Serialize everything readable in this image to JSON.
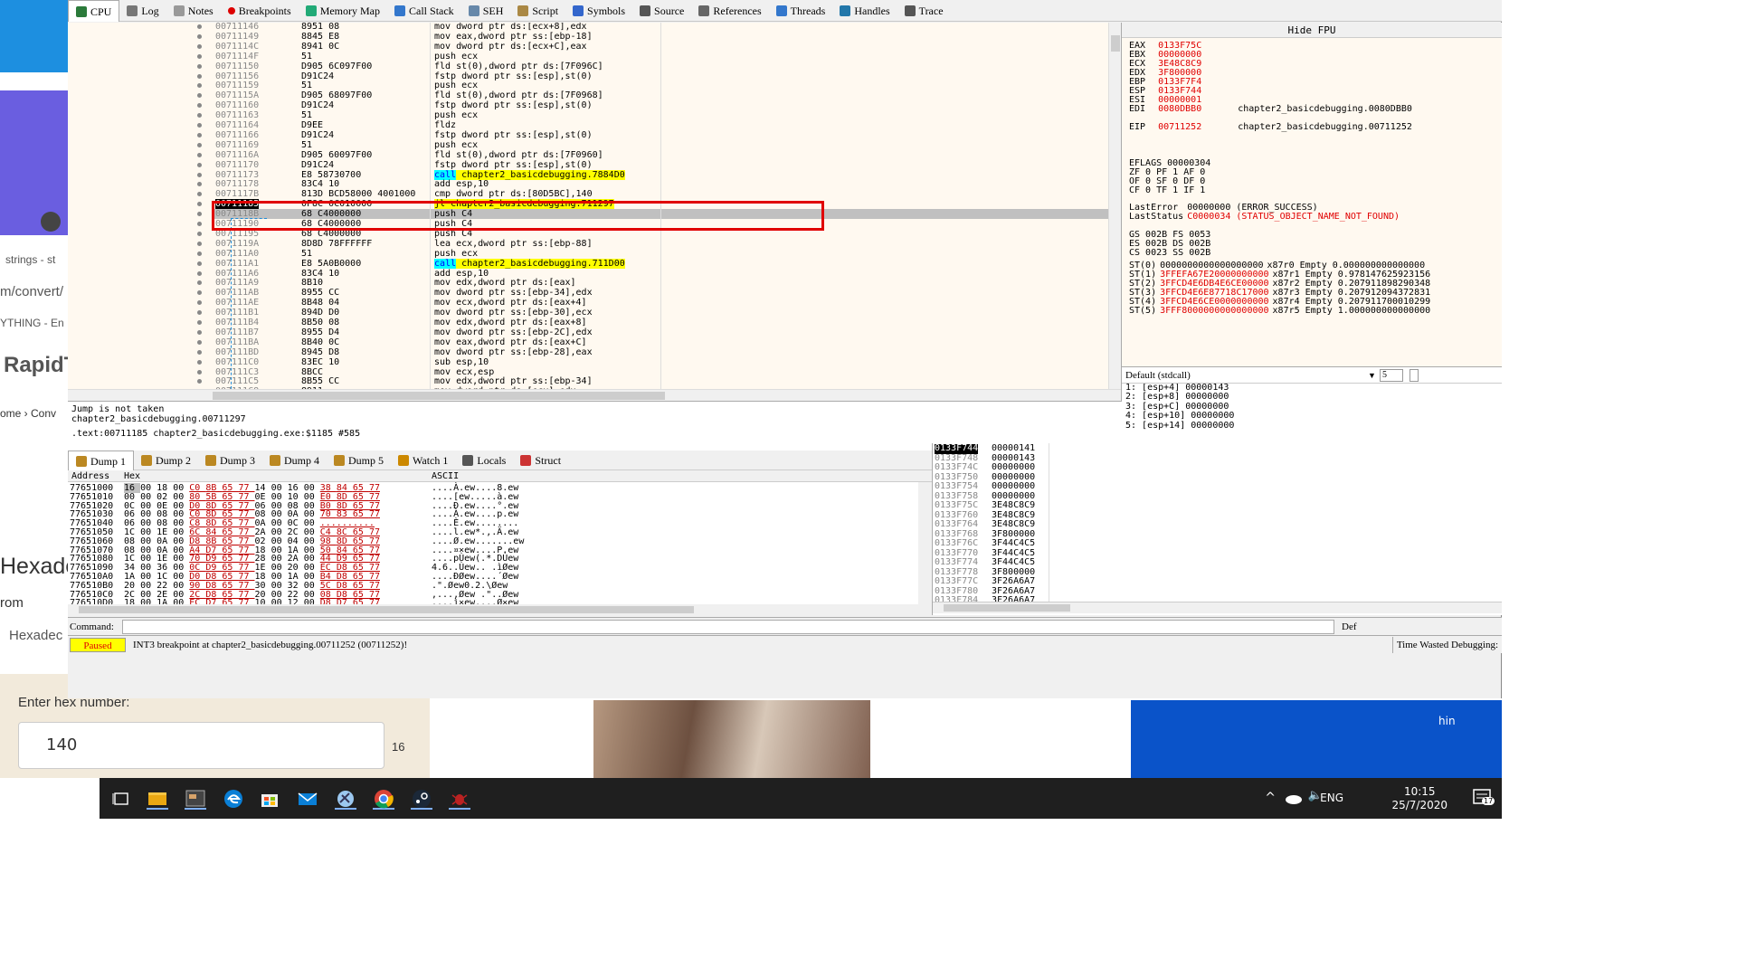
{
  "bg_browser": {
    "strings_tab": "strings - st",
    "url_fragment": "m/convert/",
    "thing_tab": "YTHING - En",
    "site_name": "RapidT",
    "breadcrumb": "ome › Conv",
    "heading_fragment": "Hexade",
    "from_label": "rom",
    "hexadec_label": "Hexadec",
    "enter_hex_label": "Enter hex number:",
    "hex_input_value": "140",
    "base_label": "16",
    "right_label": "hin"
  },
  "tabs": [
    {
      "label": "CPU",
      "icon": "cpu-icon"
    },
    {
      "label": "Log",
      "icon": "log-icon"
    },
    {
      "label": "Notes",
      "icon": "notes-icon"
    },
    {
      "label": "Breakpoints",
      "icon": "breakpoint-icon"
    },
    {
      "label": "Memory Map",
      "icon": "memory-map-icon"
    },
    {
      "label": "Call Stack",
      "icon": "call-stack-icon"
    },
    {
      "label": "SEH",
      "icon": "seh-icon"
    },
    {
      "label": "Script",
      "icon": "script-icon"
    },
    {
      "label": "Symbols",
      "icon": "symbols-icon"
    },
    {
      "label": "Source",
      "icon": "source-icon"
    },
    {
      "label": "References",
      "icon": "references-icon"
    },
    {
      "label": "Threads",
      "icon": "threads-icon"
    },
    {
      "label": "Handles",
      "icon": "handles-icon"
    },
    {
      "label": "Trace",
      "icon": "trace-icon"
    }
  ],
  "disasm": [
    {
      "addr": "00711146",
      "bytes": "8951 08",
      "instr": "mov dword ptr ds:[ecx+8],edx"
    },
    {
      "addr": "00711149",
      "bytes": "8845 E8",
      "instr": "mov eax,dword ptr ss:[ebp-18]"
    },
    {
      "addr": "0071114C",
      "bytes": "8941 0C",
      "instr": "mov dword ptr ds:[ecx+C],eax"
    },
    {
      "addr": "0071114F",
      "bytes": "51",
      "instr": "push ecx"
    },
    {
      "addr": "00711150",
      "bytes": "D905 6C097F00",
      "instr": "fld st(0),dword ptr ds:[7F096C]"
    },
    {
      "addr": "00711156",
      "bytes": "D91C24",
      "instr": "fstp dword ptr ss:[esp],st(0)"
    },
    {
      "addr": "00711159",
      "bytes": "51",
      "instr": "push ecx"
    },
    {
      "addr": "0071115A",
      "bytes": "D905 68097F00",
      "instr": "fld st(0),dword ptr ds:[7F0968]"
    },
    {
      "addr": "00711160",
      "bytes": "D91C24",
      "instr": "fstp dword ptr ss:[esp],st(0)"
    },
    {
      "addr": "00711163",
      "bytes": "51",
      "instr": "push ecx"
    },
    {
      "addr": "00711164",
      "bytes": "D9EE",
      "instr": "fldz"
    },
    {
      "addr": "00711166",
      "bytes": "D91C24",
      "instr": "fstp dword ptr ss:[esp],st(0)"
    },
    {
      "addr": "00711169",
      "bytes": "51",
      "instr": "push ecx"
    },
    {
      "addr": "0071116A",
      "bytes": "D905 60097F00",
      "instr": "fld st(0),dword ptr ds:[7F0960]"
    },
    {
      "addr": "00711170",
      "bytes": "D91C24",
      "instr": "fstp dword ptr ss:[esp],st(0)"
    },
    {
      "addr": "00711173",
      "bytes": "E8 58730700",
      "instr": "call chapter2_basicdebugging.7884D0",
      "hl": "call"
    },
    {
      "addr": "00711178",
      "bytes": "83C4 10",
      "instr": "add esp,10"
    },
    {
      "addr": "0071117B",
      "bytes": "813D BCD58000 4001000",
      "instr": "cmp dword ptr ds:[80D5BC],140"
    },
    {
      "addr": "00711185",
      "bytes": "0F8C 0C010000",
      "instr": "jl chapter2_basicdebugging.711297",
      "hl": "jmp",
      "current": true
    },
    {
      "addr": "0071118B",
      "bytes": "68 C4000000",
      "instr": "push C4"
    },
    {
      "addr": "00711190",
      "bytes": "68 C4000000",
      "instr": "push C4"
    },
    {
      "addr": "00711195",
      "bytes": "68 C4000000",
      "instr": "push C4"
    },
    {
      "addr": "0071119A",
      "bytes": "8D8D 78FFFFFF",
      "instr": "lea ecx,dword ptr ss:[ebp-88]"
    },
    {
      "addr": "007111A0",
      "bytes": "51",
      "instr": "push ecx"
    },
    {
      "addr": "007111A1",
      "bytes": "E8 5A0B0000",
      "instr": "call chapter2_basicdebugging.711D00",
      "hl": "call"
    },
    {
      "addr": "007111A6",
      "bytes": "83C4 10",
      "instr": "add esp,10"
    },
    {
      "addr": "007111A9",
      "bytes": "8B10",
      "instr": "mov edx,dword ptr ds:[eax]"
    },
    {
      "addr": "007111AB",
      "bytes": "8955 CC",
      "instr": "mov dword ptr ss:[ebp-34],edx"
    },
    {
      "addr": "007111AE",
      "bytes": "8B48 04",
      "instr": "mov ecx,dword ptr ds:[eax+4]"
    },
    {
      "addr": "007111B1",
      "bytes": "894D D0",
      "instr": "mov dword ptr ss:[ebp-30],ecx"
    },
    {
      "addr": "007111B4",
      "bytes": "8B50 08",
      "instr": "mov edx,dword ptr ds:[eax+8]"
    },
    {
      "addr": "007111B7",
      "bytes": "8955 D4",
      "instr": "mov dword ptr ss:[ebp-2C],edx"
    },
    {
      "addr": "007111BA",
      "bytes": "8B40 0C",
      "instr": "mov eax,dword ptr ds:[eax+C]"
    },
    {
      "addr": "007111BD",
      "bytes": "8945 D8",
      "instr": "mov dword ptr ss:[ebp-28],eax"
    },
    {
      "addr": "007111C0",
      "bytes": "83EC 10",
      "instr": "sub esp,10"
    },
    {
      "addr": "007111C3",
      "bytes": "8BCC",
      "instr": "mov ecx,esp"
    },
    {
      "addr": "007111C5",
      "bytes": "8B55 CC",
      "instr": "mov edx,dword ptr ss:[ebp-34]"
    },
    {
      "addr": "007111C8",
      "bytes": "8911",
      "instr": "mov dword ptr ds:[ecx],edx"
    }
  ],
  "info": {
    "line1": "Jump is not taken",
    "line2": "chapter2_basicdebugging.00711297",
    "line3": ".text:00711185 chapter2_basicdebugging.exe:$1185 #585"
  },
  "regs": {
    "header": "Hide FPU",
    "rows": [
      {
        "n": "EAX",
        "v": "0133F75C",
        "c": ""
      },
      {
        "n": "EBX",
        "v": "00000000",
        "c": ""
      },
      {
        "n": "ECX",
        "v": "3E48C8C9",
        "c": ""
      },
      {
        "n": "EDX",
        "v": "3F800000",
        "c": ""
      },
      {
        "n": "EBP",
        "v": "0133F7F4",
        "c": ""
      },
      {
        "n": "ESP",
        "v": "0133F744",
        "c": ""
      },
      {
        "n": "ESI",
        "v": "00000001",
        "c": ""
      },
      {
        "n": "EDI",
        "v": "0080DBB0",
        "c": "chapter2_basicdebugging.0080DBB0"
      },
      {
        "n": "EIP",
        "v": "00711252",
        "c": "chapter2_basicdebugging.00711252"
      }
    ],
    "eflags": "EFLAGS   00000304",
    "flags1": "ZF 0  PF 1  AF 0",
    "flags2": "OF 0  SF 0  DF 0",
    "flags3": "CF 0  TF 1  IF 1",
    "lasterror_label": "LastError",
    "lasterror_val": "00000000 (ERROR_SUCCESS)",
    "laststatus_label": "LastStatus",
    "laststatus_val": "C0000034 (STATUS_OBJECT_NAME_NOT_FOUND)",
    "seg1": "GS 002B  FS 0053",
    "seg2": "ES 002B  DS 002B",
    "seg3": "CS 0023  SS 002B",
    "fpu": [
      {
        "n": "ST(0)",
        "v": "0000000000000000000",
        "t": "x87r0 Empty 0.000000000000000"
      },
      {
        "n": "ST(1)",
        "v": "3FFEFA67E20000000000",
        "t": "x87r1 Empty 0.978147625923156"
      },
      {
        "n": "ST(2)",
        "v": "3FFCD4E6DB4E6CE00000",
        "t": "x87r2 Empty 0.207911898290348"
      },
      {
        "n": "ST(3)",
        "v": "3FFCD4E6E87718C17000",
        "t": "x87r3 Empty 0.207912094372831"
      },
      {
        "n": "ST(4)",
        "v": "3FFCD4E6CE0000000000",
        "t": "x87r4 Empty 0.207911700010299"
      },
      {
        "n": "ST(5)",
        "v": "3FFF8000000000000000",
        "t": "x87r5 Empty 1.000000000000000"
      }
    ]
  },
  "args": {
    "convention": "Default (stdcall)",
    "count": "5",
    "rows": [
      "1: [esp+4]  00000143",
      "2: [esp+8]  00000000",
      "3: [esp+C]  00000000",
      "4: [esp+10]  00000000",
      "5: [esp+14]  00000000"
    ]
  },
  "dump_tabs": [
    {
      "label": "Dump 1",
      "icon": "dump-icon"
    },
    {
      "label": "Dump 2",
      "icon": "dump-icon"
    },
    {
      "label": "Dump 3",
      "icon": "dump-icon"
    },
    {
      "label": "Dump 4",
      "icon": "dump-icon"
    },
    {
      "label": "Dump 5",
      "icon": "dump-icon"
    },
    {
      "label": "Watch 1",
      "icon": "watch-icon"
    },
    {
      "label": "Locals",
      "icon": "locals-icon"
    },
    {
      "label": "Struct",
      "icon": "struct-icon"
    }
  ],
  "dump_headers": {
    "address": "Address",
    "hex": "Hex",
    "ascii": "ASCII"
  },
  "dump": [
    {
      "a": "77651000",
      "h": "16 00 18 00 C0 8B 65 77 14 00 16 00 38 84 65 77",
      "s": "....À.ew....8.ew"
    },
    {
      "a": "77651010",
      "h": "00 00 02 00 80 5B 65 77 0E 00 10 00 E0 8D 65 77",
      "s": "....[ew.....à.ew"
    },
    {
      "a": "77651020",
      "h": "0C 00 0E 00 D0 8D 65 77 06 00 08 00 B0 8D 65 77",
      "s": "....Ð.ew....°.ew"
    },
    {
      "a": "77651030",
      "h": "06 00 08 00 C0 8D 65 77 08 00 0A 00 70 83 65 77",
      "s": "....À.ew....p.ew"
    },
    {
      "a": "77651040",
      "h": "06 00 08 00 C8 8D 65 77 0A 00 0C 00 ..........",
      "s": "....È.ew........"
    },
    {
      "a": "77651050",
      "h": "1C 00 1E 00 6C 84 65 77 2A 00 2C 00 C4 8C 65 77",
      "s": "....l.ew*.,.Ä.ew"
    },
    {
      "a": "77651060",
      "h": "08 00 0A 00 D8 8B 65 77 02 00 04 00 98 8D 65 77",
      "s": "....Ø.ew.......ew"
    },
    {
      "a": "77651070",
      "h": "08 00 0A 00 A4 D7 65 77 18 00 1A 00 50 84 65 77",
      "s": "....¤×ew....P.ew"
    },
    {
      "a": "77651080",
      "h": "1C 00 1E 00 70 D9 65 77 28 00 2A 00 44 D9 65 77",
      "s": "....pÙew(.*.DÙew"
    },
    {
      "a": "77651090",
      "h": "34 00 36 00 0C D9 65 77 1E 00 20 00 EC D8 65 77",
      "s": "4.6..Ùew.. .ìØew"
    },
    {
      "a": "776510A0",
      "h": "1A 00 1C 00 D0 D8 65 77 18 00 1A 00 B4 D8 65 77",
      "s": "....ÐØew....´Øew"
    },
    {
      "a": "776510B0",
      "h": "20 00 22 00 90 D8 65 77 30 00 32 00 5C D8 65 77",
      "s": " .\".Øew0.2.\\Øew"
    },
    {
      "a": "776510C0",
      "h": "2C 00 2E 00 2C D8 65 77 20 00 22 00 08 D8 65 77",
      "s": ",...,Øew .\"..Øew"
    },
    {
      "a": "776510D0",
      "h": "18 00 1A 00 EC D7 65 77 10 00 12 00 D8 D7 65 77",
      "s": "....ì×ew....Ø×ew"
    }
  ],
  "stack": [
    {
      "a": "0133F744",
      "v": "00000141",
      "cur": true
    },
    {
      "a": "0133F748",
      "v": "00000143"
    },
    {
      "a": "0133F74C",
      "v": "00000000"
    },
    {
      "a": "0133F750",
      "v": "00000000"
    },
    {
      "a": "0133F754",
      "v": "00000000"
    },
    {
      "a": "0133F758",
      "v": "00000000"
    },
    {
      "a": "0133F75C",
      "v": "3E48C8C9"
    },
    {
      "a": "0133F760",
      "v": "3E48C8C9"
    },
    {
      "a": "0133F764",
      "v": "3E48C8C9"
    },
    {
      "a": "0133F768",
      "v": "3F800000"
    },
    {
      "a": "0133F76C",
      "v": "3F44C4C5"
    },
    {
      "a": "0133F770",
      "v": "3F44C4C5"
    },
    {
      "a": "0133F774",
      "v": "3F44C4C5"
    },
    {
      "a": "0133F778",
      "v": "3F800000"
    },
    {
      "a": "0133F77C",
      "v": "3F26A6A7"
    },
    {
      "a": "0133F780",
      "v": "3F26A6A7"
    },
    {
      "a": "0133F784",
      "v": "3F26A6A7"
    }
  ],
  "command": {
    "label": "Command:",
    "right": "Def"
  },
  "status": {
    "paused": "Paused",
    "message": "INT3 breakpoint at chapter2_basicdebugging.00711252 (00711252)!",
    "time_wasted": "Time Wasted Debugging:"
  },
  "taskbar": {
    "lang": "ENG",
    "time": "10:15",
    "date": "25/7/2020",
    "notif_count": "17"
  }
}
